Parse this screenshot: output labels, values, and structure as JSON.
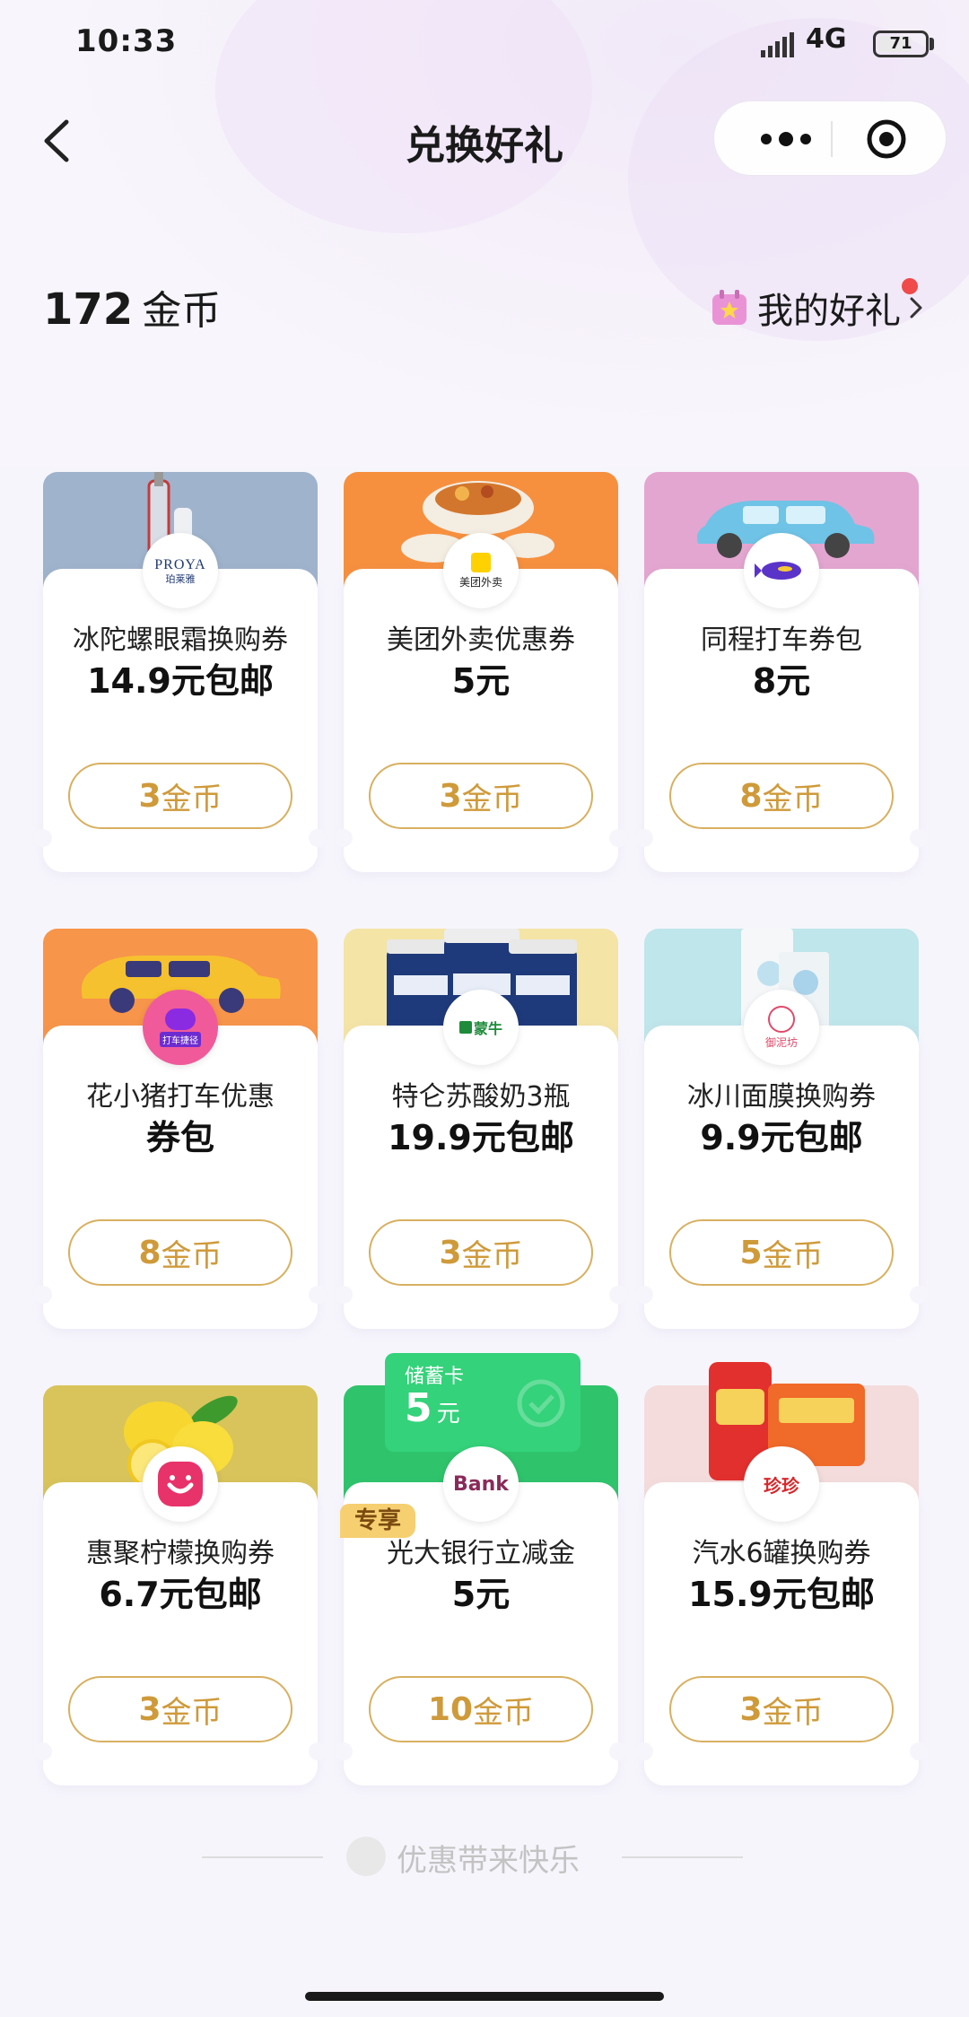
{
  "status_bar": {
    "time": "10:33",
    "network": "4G",
    "battery": "71",
    "battery_level": 0.71
  },
  "nav": {
    "title": "兑换好礼"
  },
  "header": {
    "coins": "172",
    "coins_unit": "金币",
    "my_gifts_label": "我的好礼"
  },
  "colors": {
    "accent_gold": "#cf9a3a",
    "button_border": "#d8b060",
    "dot_red": "#f04a4a"
  },
  "cards": [
    {
      "title": "冰陀螺眼霜换购券",
      "subtitle": "14.9元包邮",
      "coins": "3",
      "coin_unit": "金币",
      "banner_color": "#9fb3cc",
      "logo_text": "PROYA",
      "logo_sub": "珀莱雅"
    },
    {
      "title": "美团外卖优惠券",
      "subtitle": "5元",
      "coins": "3",
      "coin_unit": "金币",
      "banner_color": "#f6903f",
      "logo_text": "美团外卖"
    },
    {
      "title": "同程打车券包",
      "subtitle": "8元",
      "coins": "8",
      "coin_unit": "金币",
      "banner_color": "#e3a6d0"
    },
    {
      "title": "花小猪打车优惠",
      "subtitle": "券包",
      "coins": "8",
      "coin_unit": "金币",
      "banner_color": "#f7954a",
      "logo_text": "打车捷径"
    },
    {
      "title": "特仑苏酸奶3瓶",
      "subtitle": "19.9元包邮",
      "coins": "3",
      "coin_unit": "金币",
      "banner_color": "#f4e4a6",
      "logo_text": "蒙牛"
    },
    {
      "title": "冰川面膜换购券",
      "subtitle": "9.9元包邮",
      "coins": "5",
      "coin_unit": "金币",
      "banner_color": "#bfe6ea",
      "logo_text": "御泥坊"
    },
    {
      "title": "惠聚柠檬换购券",
      "subtitle": "6.7元包邮",
      "coins": "3",
      "coin_unit": "金币",
      "banner_color": "#d8c45a"
    },
    {
      "title": "光大银行立减金",
      "subtitle": "5元",
      "coins": "10",
      "coin_unit": "金币",
      "banner_color": "#2fc46c",
      "tag": "专享",
      "banner_label": "储蓄卡",
      "banner_amount": "5",
      "banner_unit": "元",
      "logo_text": "Bank"
    },
    {
      "title": "汽水6罐换购券",
      "subtitle": "15.9元包邮",
      "coins": "3",
      "coin_unit": "金币",
      "banner_color": "#f4dcdc",
      "logo_text": "珍珍"
    }
  ],
  "footer": {
    "text": "优惠带来快乐"
  }
}
